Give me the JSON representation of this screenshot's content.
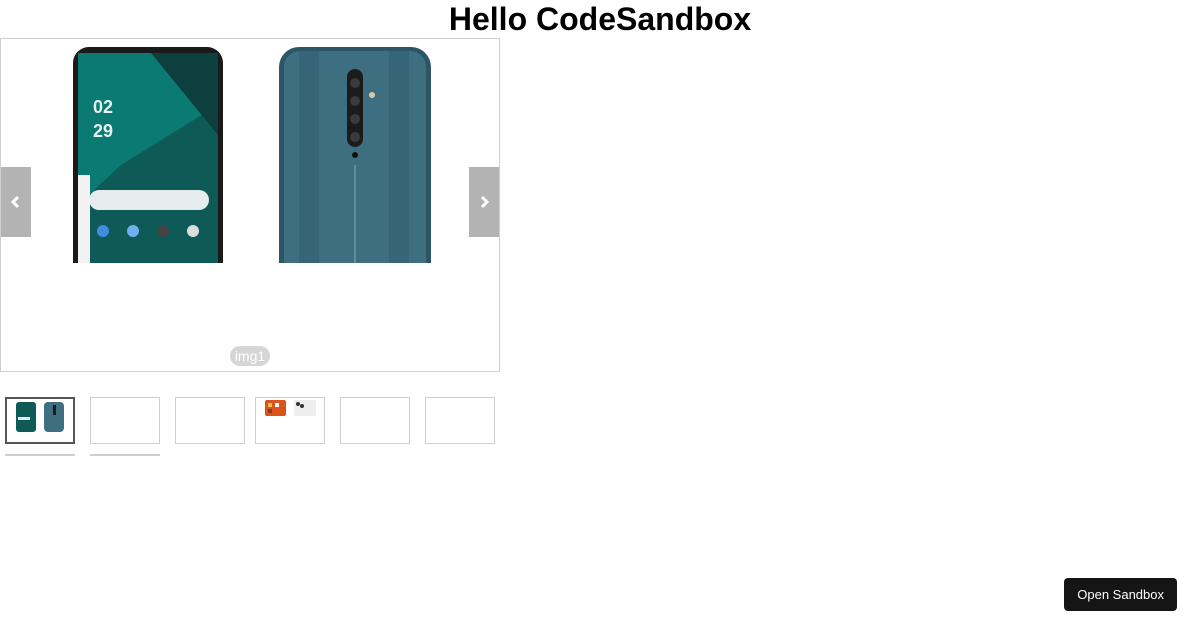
{
  "page": {
    "title": "Hello CodeSandbox"
  },
  "carousel": {
    "current_caption": "img1",
    "prev_icon": "chevron-left-icon",
    "next_icon": "chevron-right-icon",
    "thumbnails": [
      {
        "name": "img1",
        "active": true
      },
      {
        "name": "img2",
        "active": false
      },
      {
        "name": "img3",
        "active": false
      },
      {
        "name": "img4",
        "active": false
      },
      {
        "name": "img5",
        "active": false
      },
      {
        "name": "img6",
        "active": false
      },
      {
        "name": "img7",
        "active": false
      },
      {
        "name": "img8",
        "active": false
      }
    ]
  },
  "sandbox": {
    "open_label": "Open Sandbox"
  },
  "colors": {
    "nav_button": "#b3b3b3",
    "phone_teal": "#3d6f80",
    "open_button": "#151515"
  }
}
